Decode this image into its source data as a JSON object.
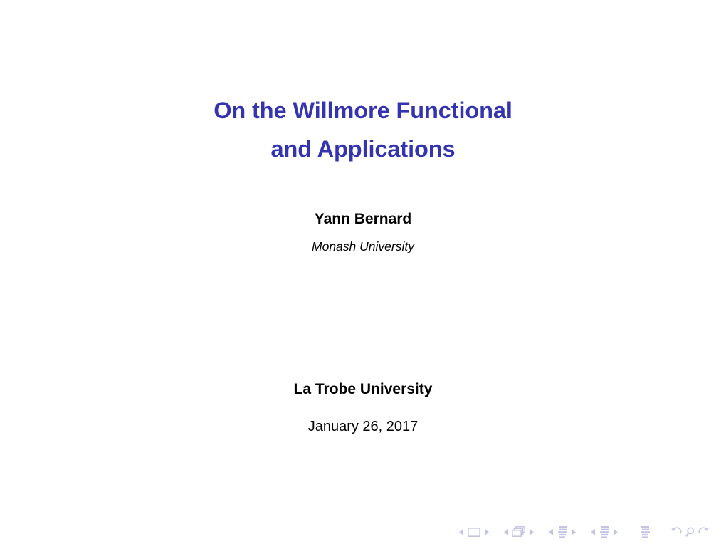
{
  "slide": {
    "background_color": "#ffffff",
    "title": {
      "color": "#3434b0",
      "lines": [
        "On the Willmore Functional",
        "and Applications"
      ]
    },
    "author": {
      "name": "Yann Bernard",
      "affiliation": "Monash University"
    },
    "venue": {
      "name": "La Trobe University",
      "date": "January 26, 2017"
    }
  },
  "navigation": {
    "color": "#c3c3e6",
    "groups": [
      {
        "name": "slide-navigation",
        "buttons": [
          {
            "icon": "triangle-left-icon",
            "label": "Previous slide"
          },
          {
            "icon": "frame-icon",
            "label": "Current slide"
          },
          {
            "icon": "triangle-right-icon",
            "label": "Next slide"
          }
        ]
      },
      {
        "name": "frame-navigation",
        "buttons": [
          {
            "icon": "triangle-left-icon",
            "label": "Previous frame"
          },
          {
            "icon": "frames-stack-icon",
            "label": "Current frame"
          },
          {
            "icon": "triangle-right-icon",
            "label": "Next frame"
          }
        ]
      },
      {
        "name": "subsection-navigation",
        "buttons": [
          {
            "icon": "triangle-left-icon",
            "label": "Previous subsection"
          },
          {
            "icon": "subsection-lines-icon",
            "label": "Current subsection"
          },
          {
            "icon": "triangle-right-icon",
            "label": "Next subsection"
          }
        ]
      },
      {
        "name": "section-navigation",
        "buttons": [
          {
            "icon": "triangle-left-icon",
            "label": "Previous section"
          },
          {
            "icon": "section-lines-icon",
            "label": "Current section"
          },
          {
            "icon": "triangle-right-icon",
            "label": "Next section"
          }
        ]
      },
      {
        "name": "document-navigation",
        "buttons": [
          {
            "icon": "document-lines-icon",
            "label": "Whole document"
          }
        ]
      },
      {
        "name": "history-navigation",
        "buttons": [
          {
            "icon": "back-arrow-icon",
            "label": "Back"
          },
          {
            "icon": "search-icon",
            "label": "Search"
          },
          {
            "icon": "forward-arrow-icon",
            "label": "Forward"
          }
        ]
      }
    ]
  }
}
